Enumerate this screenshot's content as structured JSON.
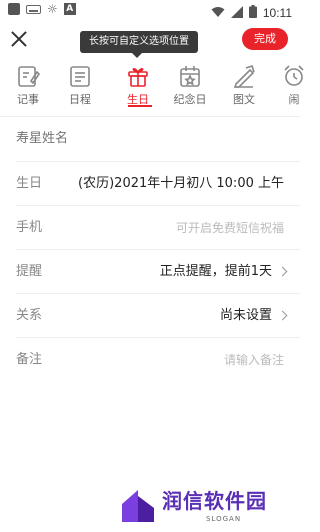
{
  "status_bar": {
    "time": "10:11",
    "left_icons": [
      "app-notification-icon",
      "keyboard-icon",
      "brightness-icon",
      "text-notification-icon"
    ],
    "right_icons": [
      "wifi-icon",
      "signal-icon",
      "battery-icon"
    ]
  },
  "header": {
    "tooltip": "长按可自定义选项位置",
    "done_label": "完成"
  },
  "tabs": [
    {
      "label": "记事",
      "icon": "note-icon",
      "active": false
    },
    {
      "label": "日程",
      "icon": "schedule-icon",
      "active": false
    },
    {
      "label": "生日",
      "icon": "gift-icon",
      "active": true
    },
    {
      "label": "纪念日",
      "icon": "anniversary-icon",
      "active": false
    },
    {
      "label": "图文",
      "icon": "image-text-icon",
      "active": false
    },
    {
      "label": "闹",
      "icon": "alarm-icon",
      "active": false
    }
  ],
  "form": {
    "name_placeholder": "寿星姓名",
    "birthday_label": "生日",
    "birthday_value": "(农历)2021年十月初八 10:00 上午",
    "phone_label": "手机",
    "phone_placeholder": "可开启免费短信祝福",
    "reminder_label": "提醒",
    "reminder_value": "正点提醒，提前1天",
    "relation_label": "关系",
    "relation_value": "尚未设置",
    "note_label": "备注",
    "note_placeholder": "请输入备注"
  },
  "watermark": {
    "brand": "润信软件园",
    "slogan": "SLOGAN"
  },
  "colors": {
    "accent": "#e8232a",
    "brand_purple": "#5a2fb5"
  }
}
